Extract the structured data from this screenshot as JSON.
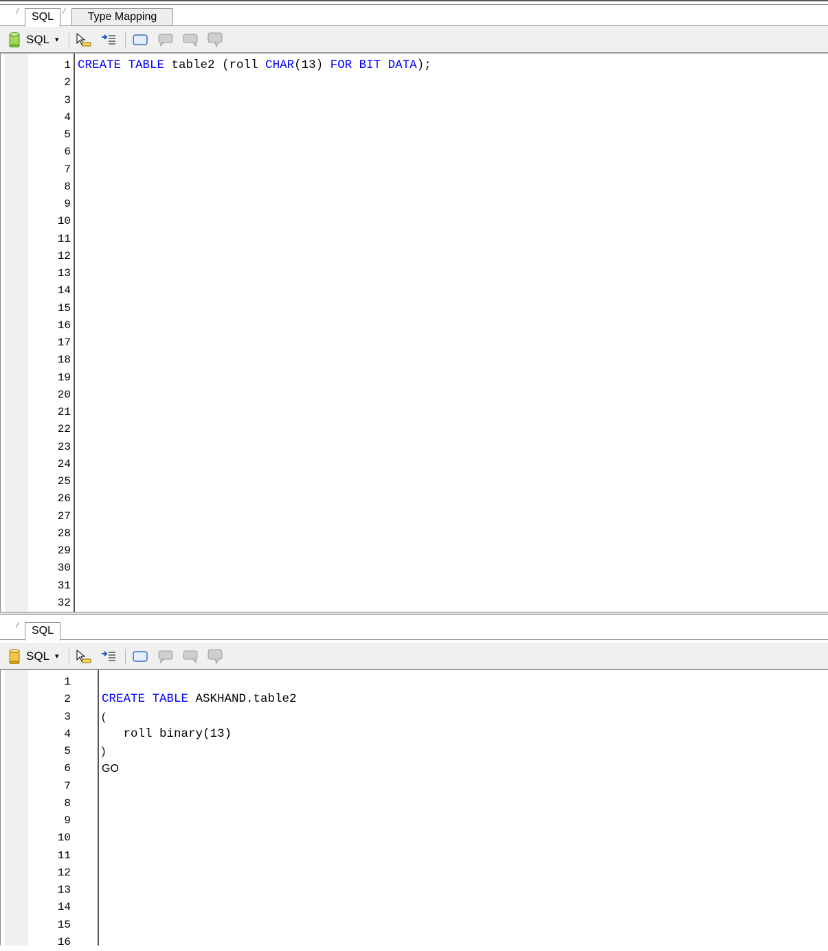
{
  "top_pane": {
    "tabs": [
      {
        "label": "SQL",
        "active": true
      },
      {
        "label": "Type Mapping",
        "active": false
      }
    ],
    "toolbar": {
      "sql_label": "SQL",
      "dropdown_caret": "▾"
    },
    "line_numbers": [
      "1",
      "2",
      "3",
      "4",
      "5",
      "6",
      "7",
      "8",
      "9",
      "10",
      "11",
      "12",
      "13",
      "14",
      "15",
      "16",
      "17",
      "18",
      "19",
      "20",
      "21",
      "22",
      "23",
      "24",
      "25",
      "26",
      "27",
      "28",
      "29",
      "30",
      "31",
      "32"
    ],
    "code": {
      "l1_kw1": "CREATE TABLE",
      "l1_t1": " table2 (roll ",
      "l1_kw2": "CHAR",
      "l1_t2": "(13) ",
      "l1_kw3": "FOR BIT DATA",
      "l1_t3": ");"
    }
  },
  "bottom_pane": {
    "tabs": [
      {
        "label": "SQL",
        "active": true
      }
    ],
    "toolbar": {
      "sql_label": "SQL",
      "dropdown_caret": "▾"
    },
    "line_numbers": [
      "1",
      "2",
      "3",
      "4",
      "5",
      "6",
      "7",
      "8",
      "9",
      "10",
      "11",
      "12",
      "13",
      "14",
      "15",
      "16"
    ],
    "code": {
      "l2_kw": "CREATE TABLE",
      "l2_t": " ASKHAND.table2",
      "l3": "(",
      "l4": "   roll binary(13)",
      "l5": ")",
      "l6": "GO"
    }
  },
  "colors": {
    "keyword": "#0000ff",
    "text": "#000000",
    "toolbar_bg": "#f0f0f0"
  },
  "icons": [
    "database-icon",
    "dropdown-caret-icon",
    "pointer-select-icon",
    "indent-icon",
    "rectangle-icon",
    "comment-icon",
    "uncomment-icon",
    "speech-bubble-icon"
  ]
}
